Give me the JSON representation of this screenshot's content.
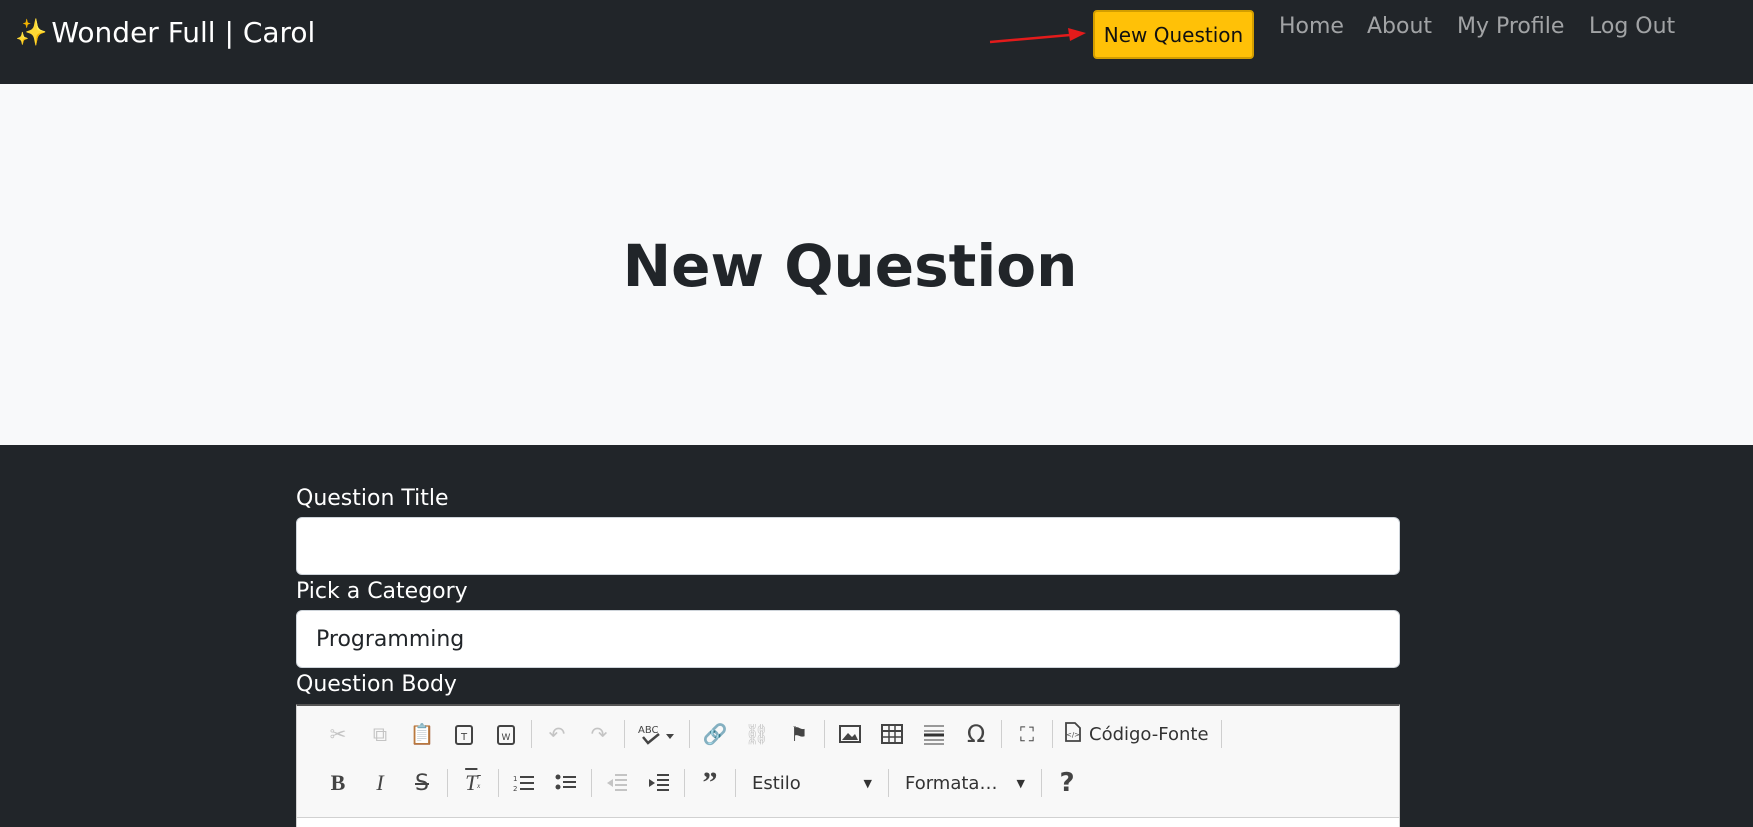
{
  "navbar": {
    "brand_icon": "sparkles-icon",
    "brand": "Wonder Full | Carol",
    "new_question_button": "New Question",
    "links": [
      "Home",
      "About",
      "My Profile",
      "Log Out"
    ],
    "accent_color": "#ffc107"
  },
  "hero": {
    "title": "New Question"
  },
  "form": {
    "title_label": "Question Title",
    "title_value": "",
    "category_label": "Pick a Category",
    "category_value": "Programming",
    "body_label": "Question Body"
  },
  "editor": {
    "style_combo": "Estilo",
    "format_combo": "Formata…",
    "source_button": "Código-Fonte"
  }
}
